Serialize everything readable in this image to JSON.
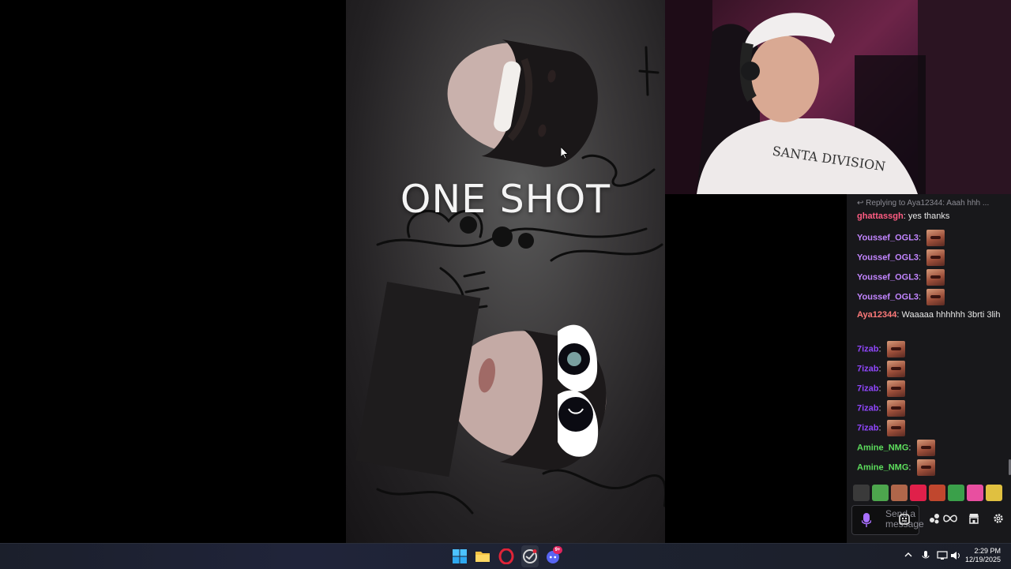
{
  "video": {
    "caption": "ONE SHOT"
  },
  "chat": {
    "reply_context": "Replying to Aya12344: Aaah hhh ...",
    "messages": [
      {
        "user": "ghattassgh",
        "color": "#ff5c82",
        "text": "yes thanks",
        "emote": false
      },
      {
        "user": "Youssef_OGL3",
        "color": "#c285ff",
        "text": "",
        "emote": true
      },
      {
        "user": "Youssef_OGL3",
        "color": "#c285ff",
        "text": "",
        "emote": true
      },
      {
        "user": "Youssef_OGL3",
        "color": "#c285ff",
        "text": "",
        "emote": true
      },
      {
        "user": "Youssef_OGL3",
        "color": "#c285ff",
        "text": "",
        "emote": true
      },
      {
        "user": "Aya12344",
        "color": "#ff7a7a",
        "text": "Waaaaa hhhhhh 3brti 3lih",
        "emote": false
      },
      {
        "user": "7izab",
        "color": "#9147ff",
        "text": "",
        "emote": true
      },
      {
        "user": "7izab",
        "color": "#9147ff",
        "text": "",
        "emote": true
      },
      {
        "user": "7izab",
        "color": "#9147ff",
        "text": "",
        "emote": true
      },
      {
        "user": "7izab",
        "color": "#9147ff",
        "text": "",
        "emote": true
      },
      {
        "user": "7izab",
        "color": "#9147ff",
        "text": "",
        "emote": true
      },
      {
        "user": "Amine_NMG",
        "color": "#5dde5d",
        "text": "",
        "emote": true
      },
      {
        "user": "Amine_NMG",
        "color": "#5dde5d",
        "text": "",
        "emote": true
      }
    ],
    "emote_picker": [
      "#3a3a3a",
      "#4da64d",
      "#b0664a",
      "#e0204a",
      "#c0472e",
      "#3aa04a",
      "#e84fa0",
      "#e0c040"
    ],
    "input_placeholder": "Send a message"
  },
  "taskbar": {
    "apps": [
      "start-icon",
      "file-explorer-icon",
      "opera-icon",
      "browser-icon",
      "discord-icon"
    ],
    "discord_badge": "9+",
    "time": "2:29 PM",
    "date": "12/19/2025"
  }
}
